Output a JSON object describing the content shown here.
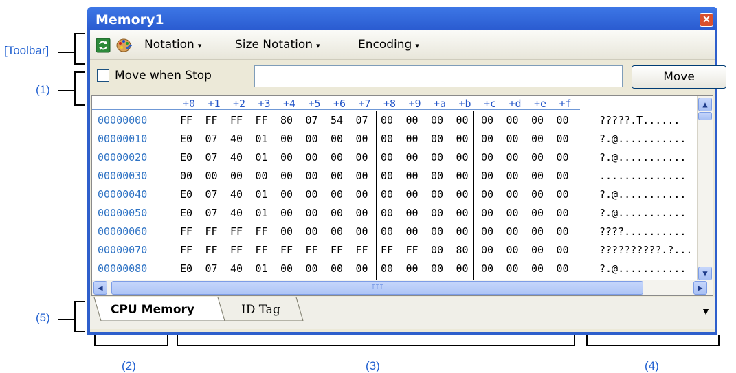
{
  "window": {
    "title": "Memory1",
    "close_glyph": "✕"
  },
  "annotations": {
    "toolbar": "[Toolbar]",
    "a1": "(1)",
    "a2": "(2)",
    "a3": "(3)",
    "a4": "(4)",
    "a5": "(5)"
  },
  "toolbar": {
    "refresh_icon": "refresh-icon",
    "palette_icon": "palette-icon",
    "menus": [
      {
        "label": "Notation",
        "arrow": "▾"
      },
      {
        "label": "Size Notation",
        "arrow": "▾"
      },
      {
        "label": "Encoding",
        "arrow": "▾"
      }
    ]
  },
  "controls": {
    "move_when_stop_label": "Move when Stop",
    "move_when_stop_checked": false,
    "address_input_value": "",
    "move_button_label": "Move"
  },
  "memory": {
    "column_headers": [
      "+0",
      "+1",
      "+2",
      "+3",
      "+4",
      "+5",
      "+6",
      "+7",
      "+8",
      "+9",
      "+a",
      "+b",
      "+c",
      "+d",
      "+e",
      "+f"
    ],
    "rows": [
      {
        "address": "00000000",
        "bytes": [
          "FF",
          "FF",
          "FF",
          "FF",
          "80",
          "07",
          "54",
          "07",
          "00",
          "00",
          "00",
          "00",
          "00",
          "00",
          "00",
          "00"
        ],
        "ascii": "?????.T......"
      },
      {
        "address": "00000010",
        "bytes": [
          "E0",
          "07",
          "40",
          "01",
          "00",
          "00",
          "00",
          "00",
          "00",
          "00",
          "00",
          "00",
          "00",
          "00",
          "00",
          "00"
        ],
        "ascii": "?.@..........."
      },
      {
        "address": "00000020",
        "bytes": [
          "E0",
          "07",
          "40",
          "01",
          "00",
          "00",
          "00",
          "00",
          "00",
          "00",
          "00",
          "00",
          "00",
          "00",
          "00",
          "00"
        ],
        "ascii": "?.@..........."
      },
      {
        "address": "00000030",
        "bytes": [
          "00",
          "00",
          "00",
          "00",
          "00",
          "00",
          "00",
          "00",
          "00",
          "00",
          "00",
          "00",
          "00",
          "00",
          "00",
          "00"
        ],
        "ascii": ".............."
      },
      {
        "address": "00000040",
        "bytes": [
          "E0",
          "07",
          "40",
          "01",
          "00",
          "00",
          "00",
          "00",
          "00",
          "00",
          "00",
          "00",
          "00",
          "00",
          "00",
          "00"
        ],
        "ascii": "?.@..........."
      },
      {
        "address": "00000050",
        "bytes": [
          "E0",
          "07",
          "40",
          "01",
          "00",
          "00",
          "00",
          "00",
          "00",
          "00",
          "00",
          "00",
          "00",
          "00",
          "00",
          "00"
        ],
        "ascii": "?.@..........."
      },
      {
        "address": "00000060",
        "bytes": [
          "FF",
          "FF",
          "FF",
          "FF",
          "00",
          "00",
          "00",
          "00",
          "00",
          "00",
          "00",
          "00",
          "00",
          "00",
          "00",
          "00"
        ],
        "ascii": "????.........."
      },
      {
        "address": "00000070",
        "bytes": [
          "FF",
          "FF",
          "FF",
          "FF",
          "FF",
          "FF",
          "FF",
          "FF",
          "FF",
          "FF",
          "00",
          "80",
          "00",
          "00",
          "00",
          "00"
        ],
        "ascii": "??????????.?..."
      },
      {
        "address": "00000080",
        "bytes": [
          "E0",
          "07",
          "40",
          "01",
          "00",
          "00",
          "00",
          "00",
          "00",
          "00",
          "00",
          "00",
          "00",
          "00",
          "00",
          "00"
        ],
        "ascii": "?.@..........."
      }
    ]
  },
  "scrollbars": {
    "up_glyph": "▲",
    "down_glyph": "▼",
    "left_glyph": "◀",
    "right_glyph": "▶",
    "grip": "III"
  },
  "tabs": [
    {
      "label": "CPU Memory",
      "active": true
    },
    {
      "label": "ID Tag",
      "active": false
    }
  ],
  "tab_dropdown_glyph": "▼",
  "colors": {
    "title_bar": "#2e5fcc",
    "address_text": "#2f73c4",
    "annotation_text": "#1f5fd0"
  }
}
